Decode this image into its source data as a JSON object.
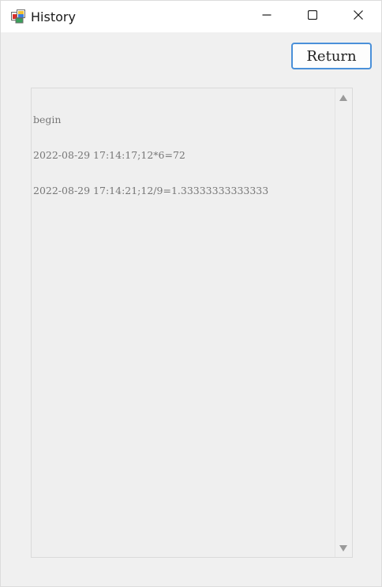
{
  "window": {
    "title": "History",
    "app_icon": "winforms-app-icon",
    "controls": {
      "minimize_icon": "minimize-icon",
      "maximize_icon": "maximize-icon",
      "close_icon": "close-icon"
    }
  },
  "toolbar": {
    "return_label": "Return"
  },
  "history": {
    "lines": [
      "begin",
      "2022-08-29 17:14:17;12*6=72",
      "2022-08-29 17:14:21;12/9=1.33333333333333"
    ]
  },
  "colors": {
    "title_bar": "#ffffff",
    "background": "#f0f0f0",
    "accent": "#4a90d9"
  }
}
